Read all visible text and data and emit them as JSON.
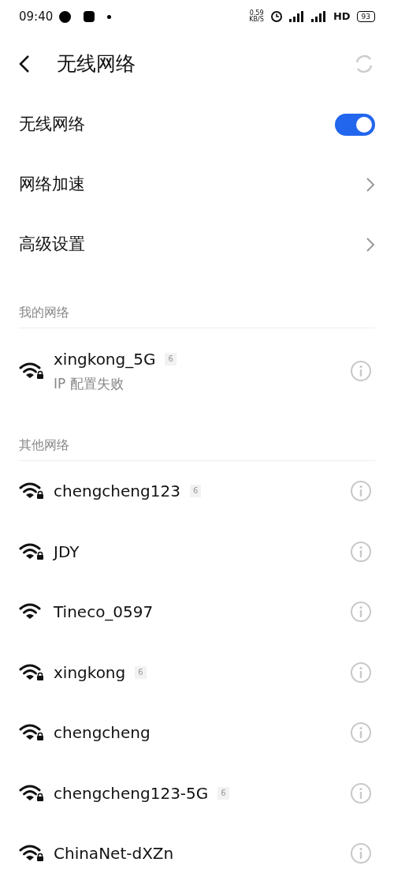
{
  "status_bar": {
    "time": "09:40",
    "speed": "0.59",
    "speed_unit": "KB/S",
    "hd": "HD",
    "battery": "93"
  },
  "header": {
    "title": "无线网络"
  },
  "settings": [
    {
      "kind": "toggle",
      "label": "无线网络",
      "on": true
    },
    {
      "kind": "link",
      "label": "网络加速"
    },
    {
      "kind": "link",
      "label": "高级设置"
    }
  ],
  "sections": [
    {
      "title": "我的网络",
      "networks": [
        {
          "name": "xingkong_5G",
          "badge": "6",
          "status": "IP 配置失败",
          "locked": true
        }
      ]
    },
    {
      "title": "其他网络",
      "networks": [
        {
          "name": "chengcheng123",
          "badge": "6",
          "locked": true
        },
        {
          "name": "JDY",
          "locked": true
        },
        {
          "name": "Tineco_0597",
          "locked": false
        },
        {
          "name": "xingkong",
          "badge": "6",
          "locked": true
        },
        {
          "name": "chengcheng",
          "locked": true
        },
        {
          "name": "chengcheng123-5G",
          "badge": "6",
          "locked": true
        },
        {
          "name": "ChinaNet-dXZn",
          "locked": true
        }
      ]
    }
  ]
}
